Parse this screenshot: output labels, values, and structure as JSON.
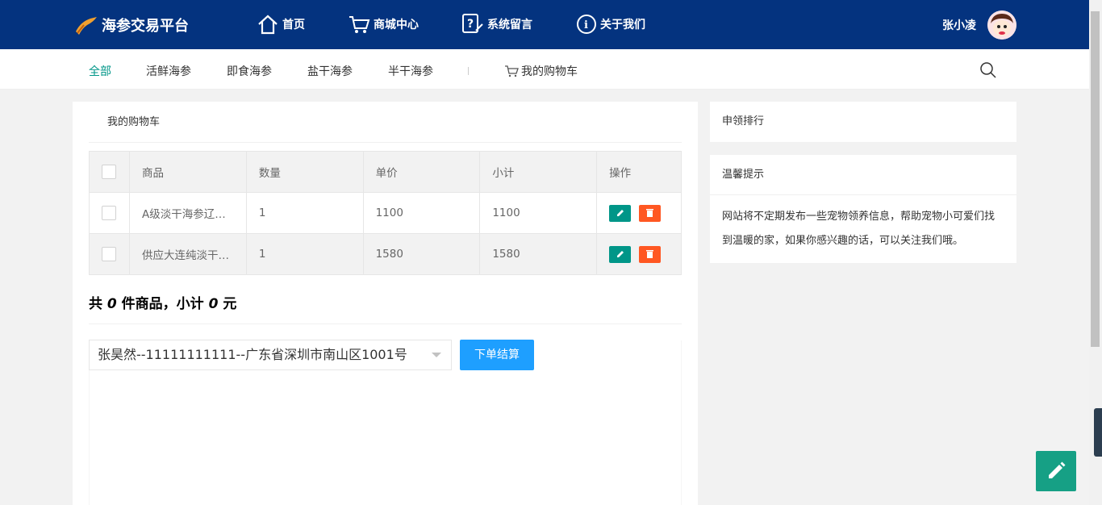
{
  "header": {
    "logo_text": "海参交易平台",
    "nav": [
      {
        "label": "首页",
        "icon": "home-icon"
      },
      {
        "label": "商城中心",
        "icon": "cart-icon"
      },
      {
        "label": "系统留言",
        "icon": "message-icon"
      },
      {
        "label": "关于我们",
        "icon": "info-icon"
      }
    ],
    "user_name": "张小凌"
  },
  "subnav": {
    "items": [
      "全部",
      "活鲜海参",
      "即食海参",
      "盐干海参",
      "半干海参"
    ],
    "active_index": 0,
    "cart_label": "我的购物车"
  },
  "main": {
    "title": "我的购物车",
    "columns": [
      "商品",
      "数量",
      "单价",
      "小计",
      "操作"
    ],
    "rows": [
      {
        "product": "A级淡干海参辽…",
        "qty": "1",
        "price": "1100",
        "subtotal": "1100"
      },
      {
        "product": "供应大连纯淡干…",
        "qty": "1",
        "price": "1580",
        "subtotal": "1580"
      }
    ],
    "summary": {
      "prefix": "共 ",
      "count": "0",
      "mid": " 件商品，小计 ",
      "total": "0",
      "suffix": " 元"
    },
    "address": "张昊然--11111111111--广东省深圳市南山区1001号",
    "order_button": "下单结算"
  },
  "side": {
    "ranking_title": "申领排行",
    "tips_title": "温馨提示",
    "tips_text": "网站将不定期发布一些宠物领养信息，帮助宠物小可爱们找到温暖的家，如果你感兴趣的话，可以关注我们哦。"
  },
  "colors": {
    "header_bg": "#04337f",
    "accent": "#009688",
    "danger": "#ff5722",
    "primary": "#1e9fff"
  }
}
